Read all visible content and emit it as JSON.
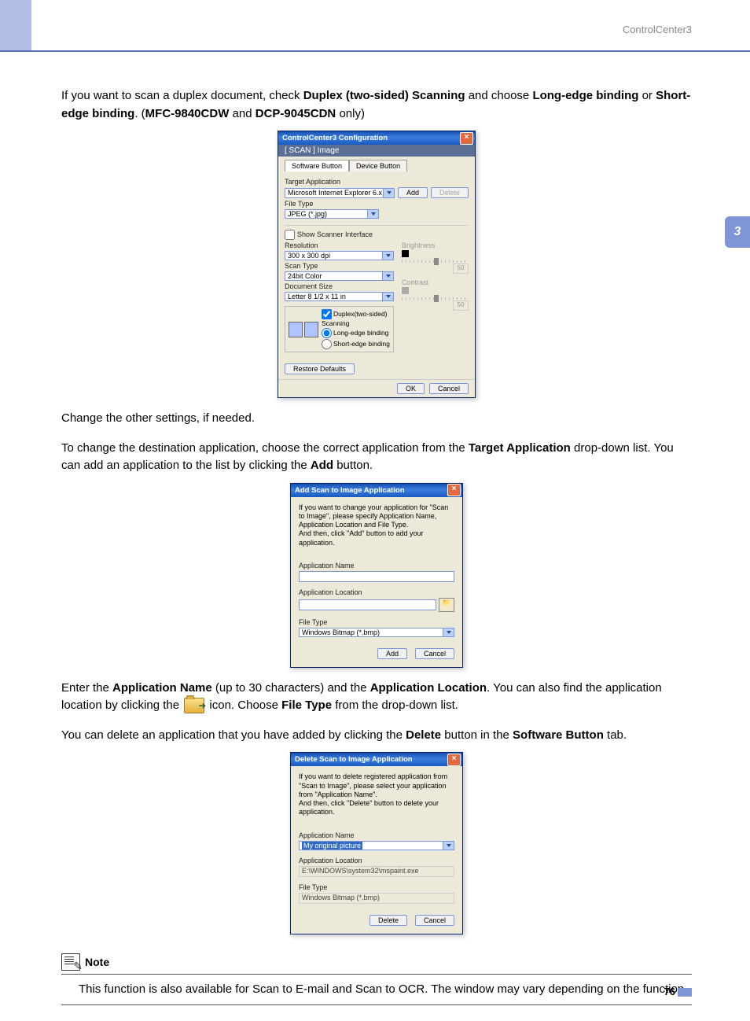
{
  "header": {
    "section": "ControlCenter3"
  },
  "chapter": "3",
  "page_number": "76",
  "para1": {
    "t1": "If you want to scan a duplex document, check ",
    "b1": "Duplex (two-sided) Scanning",
    "t2": " and choose ",
    "b2": "Long-edge binding",
    "t3": " or ",
    "b3": "Short-edge binding",
    "t4": ". (",
    "b4": "MFC-9840CDW",
    "t5": " and ",
    "b5": "DCP-9045CDN",
    "t6": " only)"
  },
  "para2": "Change the other settings, if needed.",
  "para3": {
    "t1": "To change the destination application, choose the correct application from the ",
    "b1": "Target Application",
    "t2": " drop-down list. You can add an application to the list by clicking the ",
    "b2": "Add",
    "t3": " button."
  },
  "para4": {
    "t1": "Enter the ",
    "b1": "Application Name",
    "t2": " (up to 30 characters) and the ",
    "b2": "Application Location",
    "t3": ". You can also find the application location by clicking the ",
    "t4": " icon. Choose ",
    "b3": "File Type",
    "t5": " from the drop-down list."
  },
  "para5": {
    "t1": "You can delete an application that you have added by clicking the ",
    "b1": "Delete",
    "t2": " button in the ",
    "b2": "Software Button",
    "t3": " tab."
  },
  "note": {
    "title": "Note",
    "text": "This function is also available for Scan to E-mail and Scan to OCR. The window may vary depending on the function."
  },
  "cfg_dialog": {
    "title": "ControlCenter3 Configuration",
    "subtitle": "[  SCAN  ]   Image",
    "tabs": {
      "software": "Software Button",
      "device": "Device Button"
    },
    "target_app_label": "Target Application",
    "target_app_value": "Microsoft Internet Explorer 6.x",
    "add": "Add",
    "delete": "Delete",
    "file_type_label": "File Type",
    "file_type_value": "JPEG (*.jpg)",
    "show_scanner": "Show Scanner Interface",
    "resolution_label": "Resolution",
    "resolution_value": "300 x 300 dpi",
    "scan_type_label": "Scan Type",
    "scan_type_value": "24bit Color",
    "doc_size_label": "Document Size",
    "doc_size_value": "Letter 8 1/2 x 11 in",
    "brightness_label": "Brightness",
    "contrast_label": "Contrast",
    "slider_value": "50",
    "duplex_check": "Duplex(two-sided) Scanning",
    "long_edge": "Long-edge binding",
    "short_edge": "Short-edge binding",
    "restore": "Restore Defaults",
    "ok": "OK",
    "cancel": "Cancel"
  },
  "add_dialog": {
    "title": "Add Scan to Image Application",
    "msg": "If you want to change your application for \"Scan to Image\", please specify Application Name, Application Location and File Type.\nAnd then, click \"Add\" button to add your application.",
    "app_name_label": "Application Name",
    "app_loc_label": "Application Location",
    "file_type_label": "File Type",
    "file_type_value": "Windows Bitmap (*.bmp)",
    "add": "Add",
    "cancel": "Cancel"
  },
  "del_dialog": {
    "title": "Delete Scan to Image Application",
    "msg": "If you want to delete registered application from \"Scan to Image\", please select your application from \"Application Name\".\nAnd then, click \"Delete\" button to delete your application.",
    "app_name_label": "Application Name",
    "app_name_value": "My original picture",
    "app_loc_label": "Application Location",
    "app_loc_value": "E:\\WINDOWS\\system32\\mspaint.exe",
    "file_type_label": "File Type",
    "file_type_value": "Windows Bitmap (*.bmp)",
    "delete": "Delete",
    "cancel": "Cancel"
  }
}
